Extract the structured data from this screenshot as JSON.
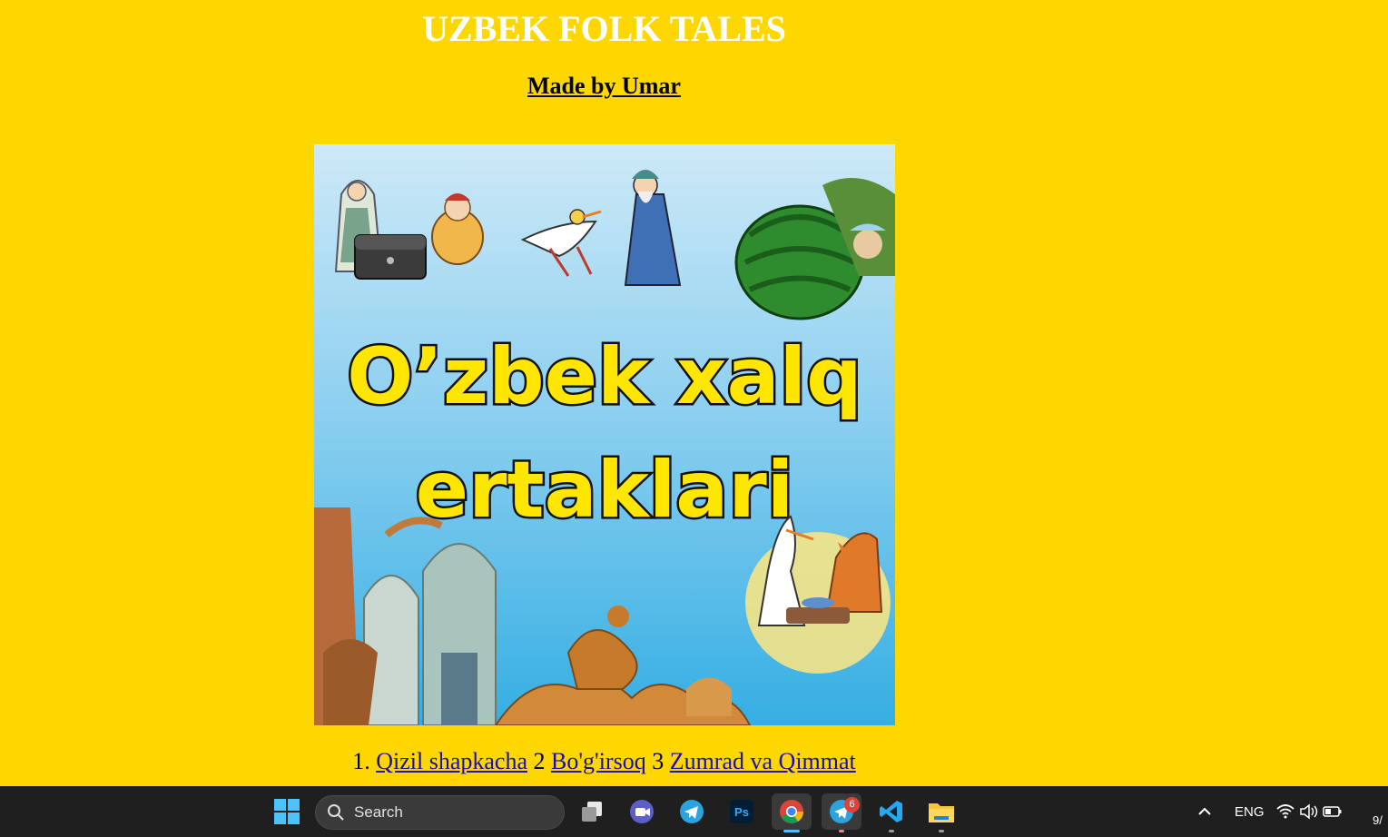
{
  "page": {
    "title": "UZBEK FOLK TALES",
    "subtitle": "Made by Umar",
    "hero_image_text": [
      "O’zbek xalq",
      "ertaklari"
    ],
    "links_prefix_1": "1. ",
    "links": [
      {
        "label": "Qizil shapkacha"
      },
      {
        "label": "Bo'g'irsoq"
      },
      {
        "label": "Zumrad va Qimmat"
      }
    ],
    "sep_2": " 2 ",
    "sep_3": " 3 "
  },
  "colors": {
    "page_background": "#FFD700",
    "title_color": "#ffffff",
    "link_color": "#1a0dab",
    "hero_text_fill": "#FFE600",
    "taskbar_background": "#1f1f1f"
  },
  "taskbar": {
    "search_placeholder": "Search",
    "apps": [
      {
        "name": "start-icon"
      },
      {
        "name": "task-view-icon"
      },
      {
        "name": "meet-icon"
      },
      {
        "name": "telegram-icon"
      },
      {
        "name": "photoshop-icon",
        "label": "Ps"
      },
      {
        "name": "chrome-icon",
        "active": true
      },
      {
        "name": "telegram-icon",
        "badge": "6"
      },
      {
        "name": "vscode-icon"
      },
      {
        "name": "file-explorer-icon"
      }
    ],
    "tray": {
      "language": "ENG",
      "clock_partial": "9/"
    }
  }
}
